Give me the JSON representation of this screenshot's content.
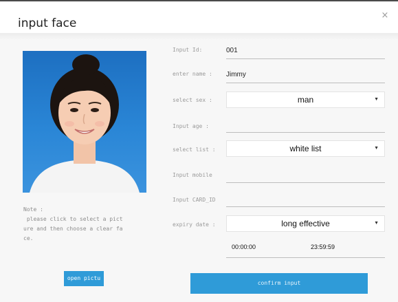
{
  "dialog": {
    "title": "input face",
    "close_glyph": "×"
  },
  "photo": {
    "description_icon": "portrait-photo"
  },
  "note": {
    "label": "Note :",
    "body": " please click to select a pict\nure and then choose a clear fa\nce."
  },
  "buttons": {
    "open_picture": "open pictu",
    "confirm": "confirm input"
  },
  "form": {
    "input_id_label": "Input Id:",
    "input_id_value": "001",
    "name_label": "enter name :",
    "name_value": "Jimmy",
    "sex_label": "select sex :",
    "sex_value": "man",
    "age_label": "Input age :",
    "age_value": "",
    "list_label": "select list :",
    "list_value": "white list",
    "mobile_label": "Input mobile",
    "mobile_value": "",
    "card_label": "Input CARD_ID",
    "card_value": "",
    "expiry_label": "expiry date :",
    "expiry_value": "long effective",
    "time_start": "00:00:00",
    "time_end": "23:59:59",
    "dropdown_glyph": "▼"
  },
  "colors": {
    "accent": "#2f9bd8",
    "photo_background": "#2a86d6"
  }
}
